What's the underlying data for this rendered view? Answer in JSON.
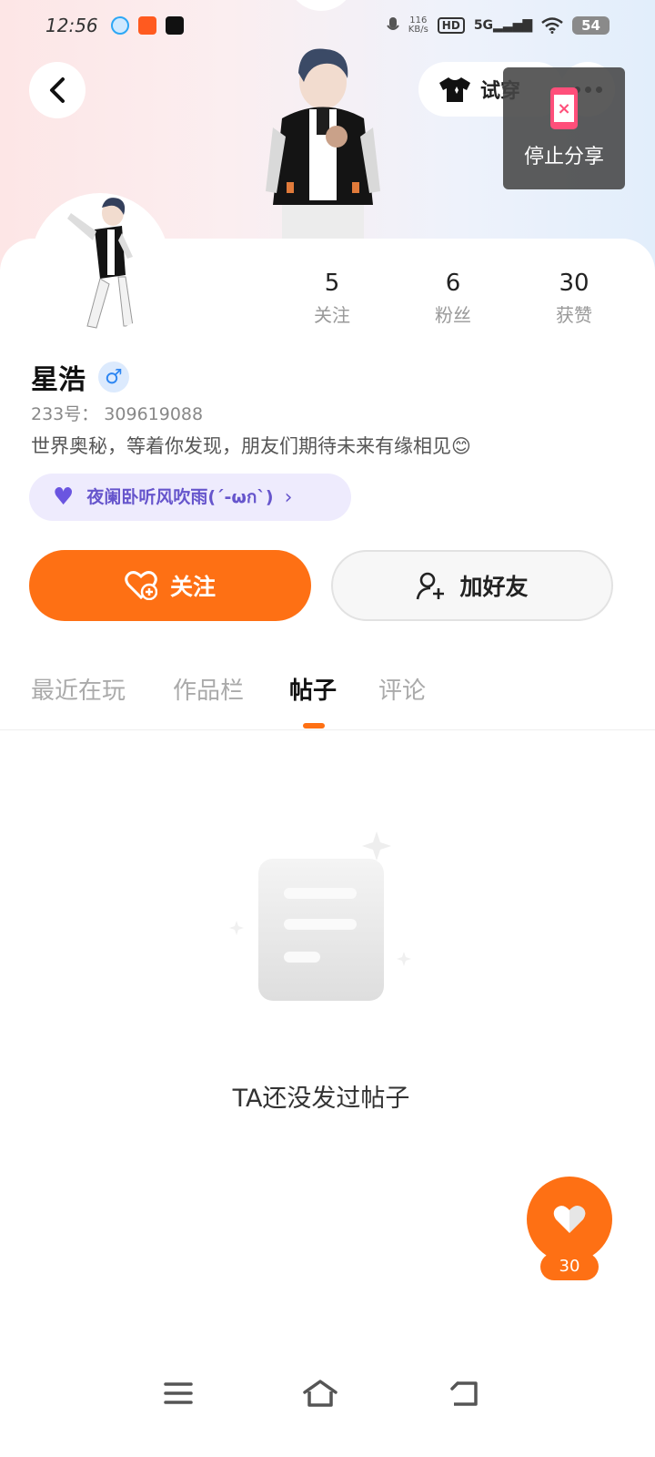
{
  "status_bar": {
    "time": "12:56",
    "net_speed_value": "116",
    "net_speed_unit": "KB/s",
    "hd": "HD",
    "signal": "5G",
    "battery": "54",
    "icons": [
      "qq-icon",
      "kuaishou-icon",
      "douyin-icon",
      "mic-icon",
      "signal-icon",
      "wifi-icon"
    ]
  },
  "header": {
    "back_icon": "chevron-left-icon",
    "tryon_label": "试穿",
    "tryon_icon": "tshirt-icon",
    "more_icon": "more-dots-icon"
  },
  "share_overlay": {
    "label": "停止分享",
    "icon": "stop-share-phone-icon",
    "icon_color": "#ff4f7a"
  },
  "profile": {
    "stats": [
      {
        "value": "5",
        "label": "关注"
      },
      {
        "value": "6",
        "label": "粉丝"
      },
      {
        "value": "30",
        "label": "获赞"
      }
    ],
    "name": "星浩",
    "gender_symbol": "♂",
    "uid": "233号： 309619088",
    "bio": "世界奥秘，等着你发现，朋友们期待未来有缘相见😊",
    "status_text": "夜阑卧听风吹雨(´-ωก`)",
    "status_chevron": "›"
  },
  "actions": {
    "follow_label": "关注",
    "add_friend_label": "加好友"
  },
  "tabs": [
    {
      "label": "最近在玩",
      "active": false
    },
    {
      "label": "作品栏",
      "active": false
    },
    {
      "label": "帖子",
      "active": true
    },
    {
      "label": "评论",
      "active": false
    }
  ],
  "empty_state": {
    "text": "TA还没发过帖子"
  },
  "like_fab": {
    "count": "30"
  },
  "nav_bar": {
    "icons": [
      "menu-icon",
      "home-icon",
      "back-icon"
    ]
  },
  "colors": {
    "accent": "#fe7014",
    "gender_blue": "#2d86f2",
    "status_purple": "#6655cc"
  }
}
